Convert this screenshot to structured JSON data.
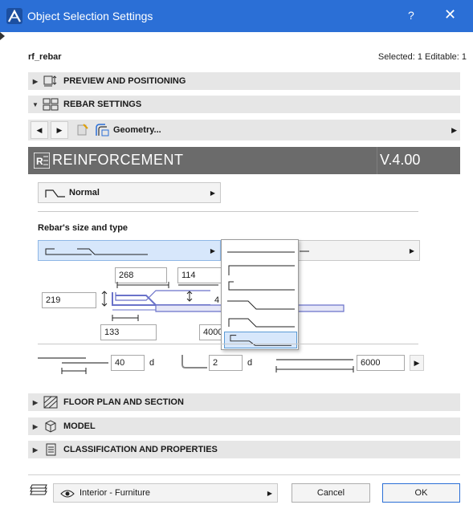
{
  "window": {
    "title": "Object Selection Settings",
    "help": "?",
    "close": "✕"
  },
  "header": {
    "object_name": "rf_rebar",
    "selection_info": "Selected: 1 Editable: 1"
  },
  "sections": {
    "preview": "PREVIEW AND POSITIONING",
    "rebar": "REBAR SETTINGS",
    "floor_plan": "FLOOR PLAN AND SECTION",
    "model": "MODEL",
    "classification": "CLASSIFICATION AND PROPERTIES"
  },
  "nav": {
    "page_label": "Geometry..."
  },
  "banner": {
    "title": "REINFORCEMENT",
    "version": "V.4.00"
  },
  "bend_type": {
    "label": "Normal"
  },
  "rebar_size_heading": "Rebar's size and type",
  "dimensions": {
    "d1": "268",
    "d2": "114",
    "d3": "4",
    "d4": "219",
    "d5": "133",
    "d6": "4000"
  },
  "anchorage": {
    "lap_value": "40",
    "lap_unit": "d",
    "hook_value": "2",
    "hook_unit": "d",
    "length_value": "6000"
  },
  "shape_popup": {
    "option_count": 6,
    "selected_index": 5
  },
  "footer": {
    "layer": "Interior - Furniture",
    "cancel": "Cancel",
    "ok": "OK"
  },
  "colors": {
    "titlebar": "#2b6fd6",
    "section_bg": "#e6e6e6",
    "banner": "#6b6b6b",
    "selection": "#d7e7fb",
    "rebar_blue": "#6a72c9"
  }
}
